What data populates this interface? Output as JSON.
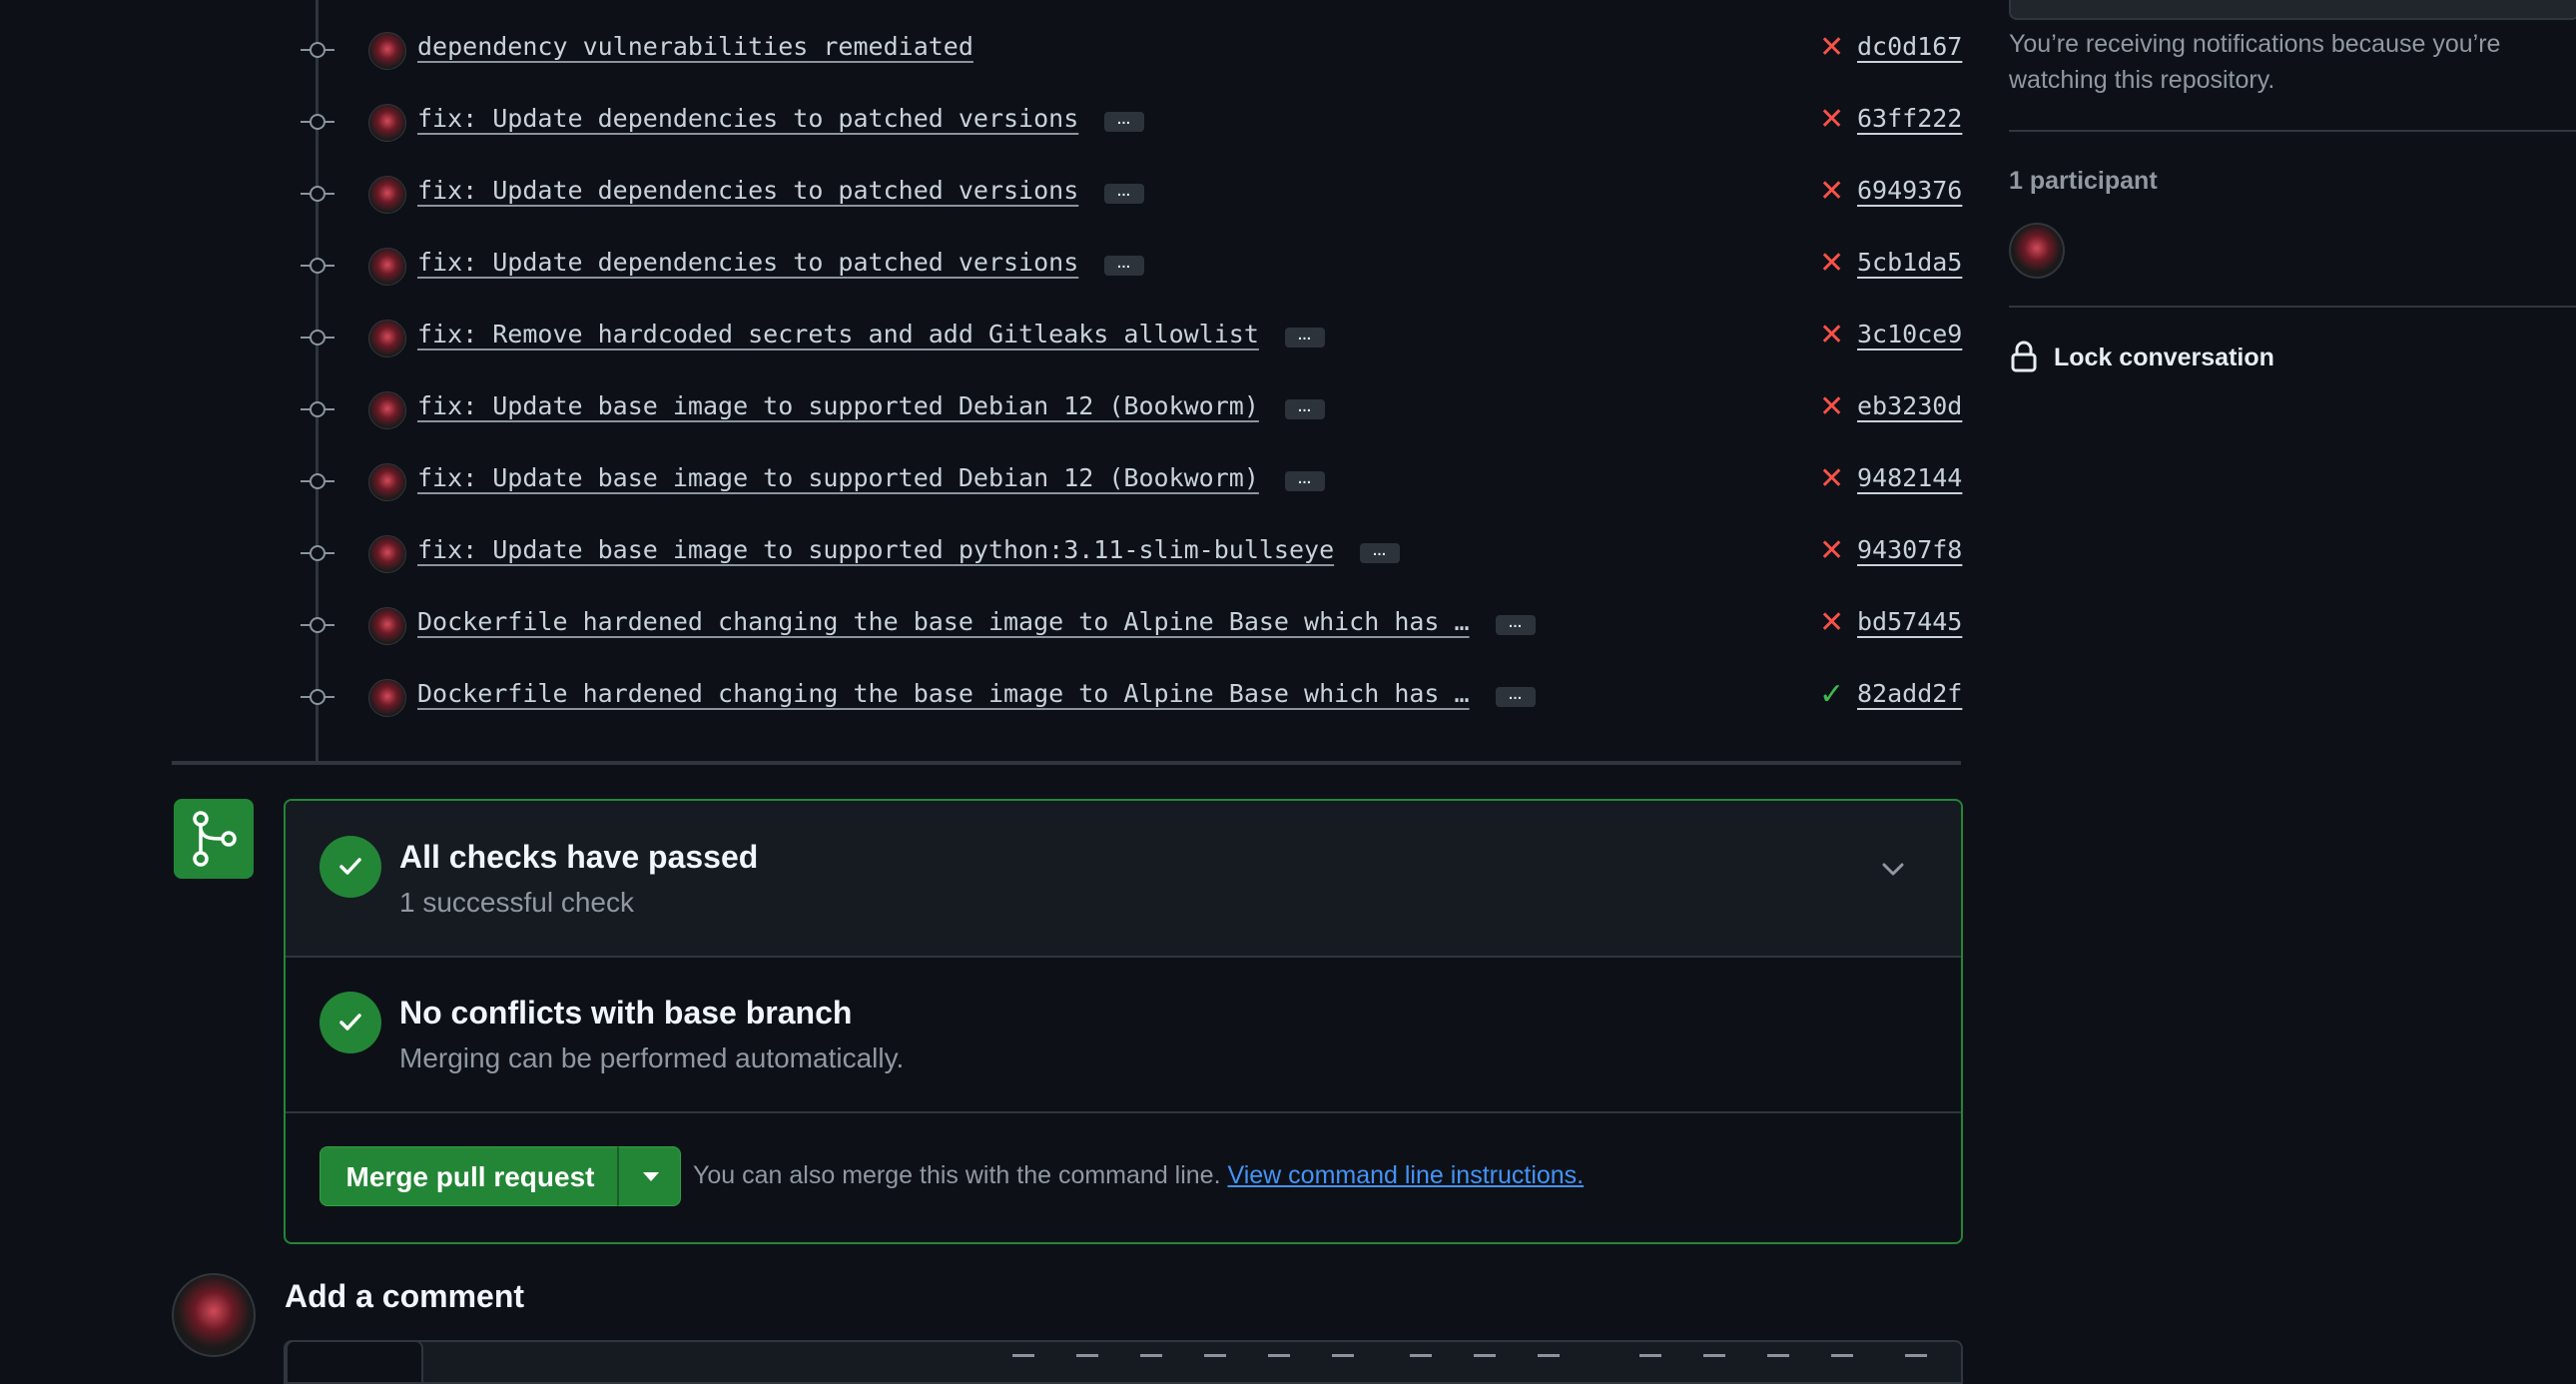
{
  "commits": [
    {
      "message": "dependency vulnerabilities remediated",
      "sha": "dc0d167",
      "status": "fail",
      "has_more": false
    },
    {
      "message": "fix: Update dependencies to patched versions",
      "sha": "63ff222",
      "status": "fail",
      "has_more": true
    },
    {
      "message": "fix: Update dependencies to patched versions",
      "sha": "6949376",
      "status": "fail",
      "has_more": true
    },
    {
      "message": "fix: Update dependencies to patched versions",
      "sha": "5cb1da5",
      "status": "fail",
      "has_more": true
    },
    {
      "message": "fix: Remove hardcoded secrets and add Gitleaks allowlist",
      "sha": "3c10ce9",
      "status": "fail",
      "has_more": true
    },
    {
      "message": "fix: Update base image to supported Debian 12 (Bookworm)",
      "sha": "eb3230d",
      "status": "fail",
      "has_more": true
    },
    {
      "message": "fix: Update base image to supported Debian 12 (Bookworm)",
      "sha": "9482144",
      "status": "fail",
      "has_more": true
    },
    {
      "message": "fix: Update base image to supported python:3.11-slim-bullseye",
      "sha": "94307f8",
      "status": "fail",
      "has_more": true
    },
    {
      "message": "Dockerfile hardened changing the base image to Alpine Base which has …",
      "sha": "bd57445",
      "status": "fail",
      "has_more": true
    },
    {
      "message": "Dockerfile hardened changing the base image to Alpine Base which has …",
      "sha": "82add2f",
      "status": "pass",
      "has_more": true
    }
  ],
  "icons": {
    "fail": "x-icon",
    "pass": "check-icon",
    "expand": "ellipsis-icon",
    "merge": "git-merge-icon",
    "chevron": "chevron-down-icon",
    "lock": "lock-icon"
  },
  "colors": {
    "background": "#0d1117",
    "success": "#238636",
    "danger": "#f85149",
    "link": "#4493f8",
    "muted": "#9198a1",
    "border": "#30363d"
  },
  "merge_box": {
    "checks": {
      "title": "All checks have passed",
      "subtitle": "1 successful check"
    },
    "conflicts": {
      "title": "No conflicts with base branch",
      "subtitle": "Merging can be performed automatically."
    },
    "merge_button_label": "Merge pull request",
    "hint_text": "You can also merge this with the command line. ",
    "hint_link": "View command line instructions."
  },
  "comment": {
    "title": "Add a comment"
  },
  "sidebar": {
    "notifications_text": "You’re receiving notifications because you’re watching this repository.",
    "participants_label": "1 participant",
    "lock_label": "Lock conversation"
  }
}
